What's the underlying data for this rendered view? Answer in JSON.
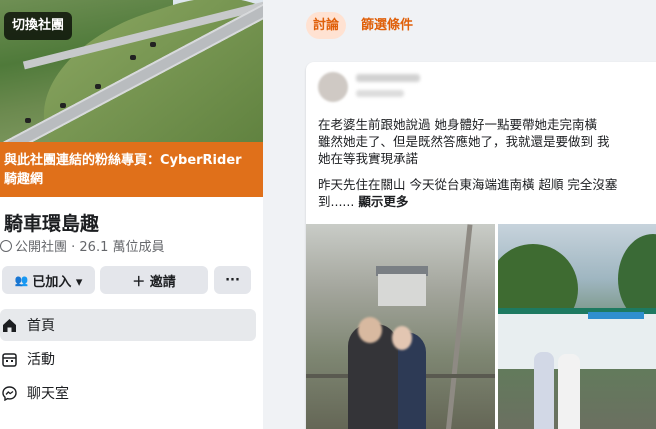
{
  "sidebar": {
    "switch_label": "切換社團",
    "fan_banner": {
      "line1": "與此社團連結的粉絲專頁：CyberRider",
      "line2": "騎趣網"
    },
    "group_name": "騎車環島趣",
    "group_meta": "公開社團 · 26.1 萬位成員",
    "buttons": {
      "joined": "已加入 ▾",
      "invite": "＋ 邀請",
      "more": "···"
    },
    "nav": [
      {
        "label": "首頁",
        "icon": "home-icon"
      },
      {
        "label": "活動",
        "icon": "calendar-icon"
      },
      {
        "label": "聊天室",
        "icon": "messenger-icon"
      }
    ]
  },
  "main": {
    "tabs": [
      {
        "label": "討論",
        "active": true
      },
      {
        "label": "篩選條件",
        "active": false
      }
    ],
    "post": {
      "lines": [
        "在老婆生前跟她說過  她身體好一點要帶她走完南橫",
        "雖然她走了、但是既然答應她了，我就還是要做到  我",
        "她在等我實現承諾"
      ],
      "line2a": "昨天先住在關山 今天從台東海端進南橫 超順 完全沒塞",
      "line2b": "到......",
      "see_more": "顯示更多"
    }
  },
  "colors": {
    "accent": "#e0600a",
    "banner": "#e0701a"
  }
}
